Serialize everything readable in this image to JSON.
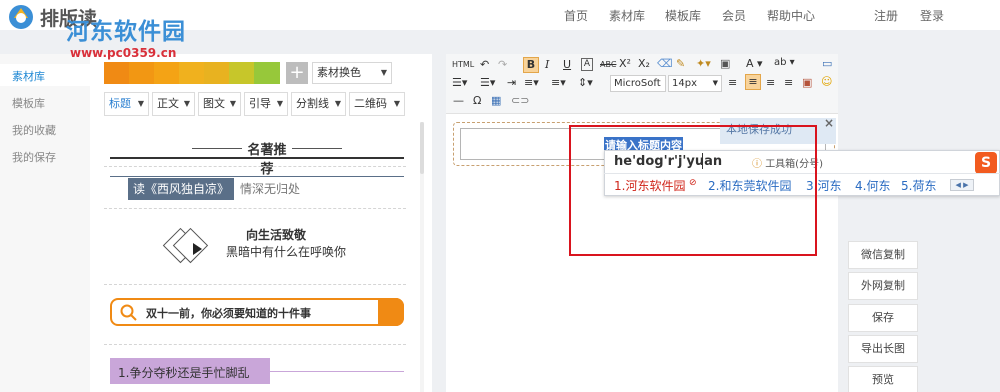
{
  "app": {
    "logo_text": "排版读"
  },
  "watermark": {
    "title": "河东软件园",
    "url": "www.pc0359.cn"
  },
  "nav": {
    "home": "首页",
    "materials": "素材库",
    "templates": "模板库",
    "member": "会员",
    "help": "帮助中心",
    "register": "注册",
    "login": "登录"
  },
  "sidebar": {
    "items": [
      {
        "label": "素材库"
      },
      {
        "label": "模板库"
      },
      {
        "label": "我的收藏"
      },
      {
        "label": "我的保存"
      }
    ]
  },
  "panel": {
    "swatch_colors": [
      "#f08a14",
      "#f29713",
      "#f4a315",
      "#f0b11e",
      "#e8b220",
      "#c7c62a",
      "#97c83a"
    ],
    "color_select": "素材换色",
    "categories": [
      {
        "label": "标题"
      },
      {
        "label": "正文"
      },
      {
        "label": "图文"
      },
      {
        "label": "引导"
      },
      {
        "label": "分割线"
      },
      {
        "label": "二维码"
      }
    ],
    "items": {
      "famous_title": "名著推荐",
      "book_name": "读《西风独自凉》",
      "book_quote": "情深无归处",
      "life_title": "向生活致敬",
      "life_sub": "黑暗中有什么在呼唤你",
      "search_text": "双十一前，你必须要知道的十件事",
      "list_text": "1.争分夺秒还是手忙脚乱"
    }
  },
  "editor": {
    "toolbar": {
      "font": "MicroSoft",
      "size": "14px"
    },
    "title_placeholder": "请输入标题内容",
    "toast": "本地保存成功",
    "toast_close": "×"
  },
  "ime": {
    "pinyin": "he'dog'r'j'yuan",
    "tools": "工具箱(分号)",
    "logo": "S",
    "candidates": [
      "1.河东软件园",
      "2.和东莞软件园",
      "3.河东",
      "4.何东",
      "5.荷东"
    ]
  },
  "actions": [
    {
      "label": "微信复制"
    },
    {
      "label": "外网复制"
    },
    {
      "label": "保存"
    },
    {
      "label": "导出长图"
    },
    {
      "label": "预览"
    }
  ]
}
